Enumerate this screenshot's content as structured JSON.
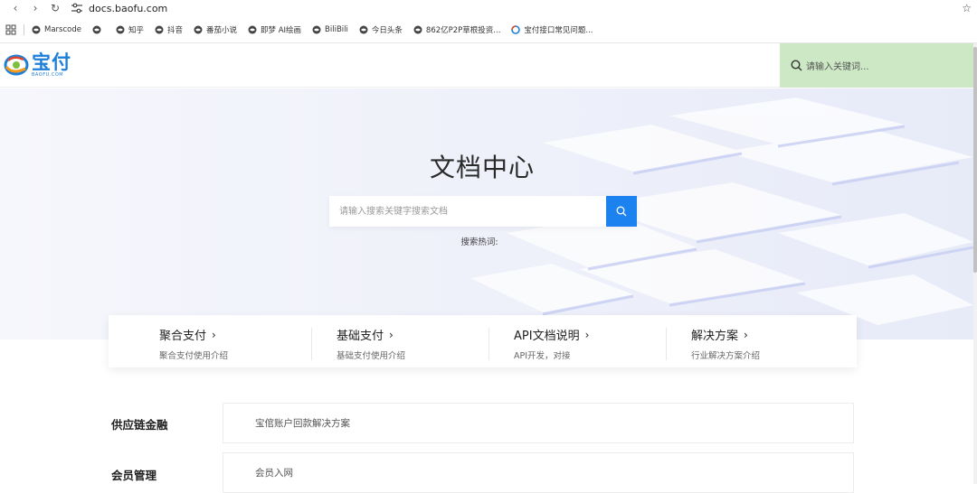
{
  "browser": {
    "url": "docs.baofu.com",
    "bookmarks": [
      "Marscode",
      "",
      "知乎",
      "抖音",
      "番茄小说",
      "即梦 AI绘画",
      "BiliBili",
      "今日头条",
      "862亿P2P草根投资...",
      "宝付接口常见问题..."
    ]
  },
  "header": {
    "logo_cn": "宝付",
    "logo_en": "BAOFU.COM",
    "search_placeholder": "请输入关键词..."
  },
  "hero": {
    "title": "文档中心",
    "search_placeholder": "请输入搜索关键字搜索文档",
    "hot_label": "搜索热词:"
  },
  "categories": [
    {
      "title": "聚合支付",
      "sub": "聚合支付使用介绍"
    },
    {
      "title": "基础支付",
      "sub": "基础支付使用介绍"
    },
    {
      "title": "API文档说明",
      "sub": "API开发，对接"
    },
    {
      "title": "解决方案",
      "sub": "行业解决方案介绍"
    }
  ],
  "sections": [
    {
      "label": "供应链金融",
      "item": "宝倌账户回款解决方案"
    },
    {
      "label": "会员管理",
      "item": "会员入网"
    }
  ],
  "colors": {
    "accent": "#1b82f0",
    "header_search_bg": "#cce8c4"
  }
}
